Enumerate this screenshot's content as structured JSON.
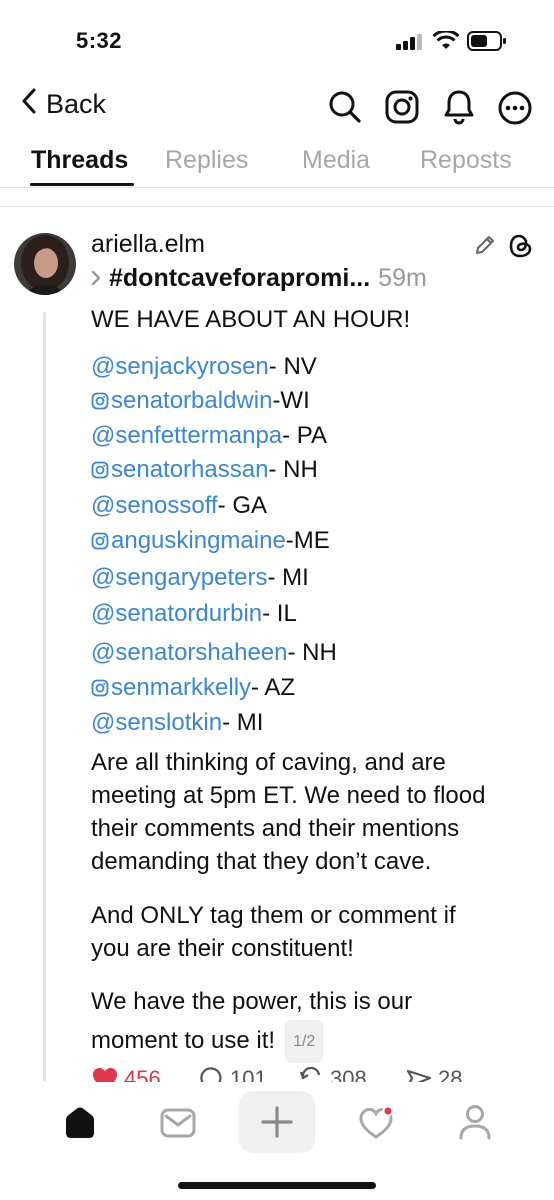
{
  "status": {
    "time": "5:32"
  },
  "nav": {
    "back_label": "Back"
  },
  "tabs": [
    "Threads",
    "Replies",
    "Media",
    "Reposts"
  ],
  "post": {
    "username": "ariella.elm",
    "tag": "#dontcaveforapromi...",
    "time": "59m",
    "headline": "WE HAVE ABOUT AN HOUR!",
    "mentions": [
      {
        "handle": "@senjackyrosen",
        "suffix": " - NV",
        "ig": false
      },
      {
        "handle": "senatorbaldwin",
        "suffix": " -WI",
        "ig": true
      },
      {
        "handle": "@senfettermanpa",
        "suffix": " - PA",
        "ig": false
      },
      {
        "handle": "senatorhassan",
        "suffix": " - NH",
        "ig": true
      },
      {
        "handle": "@senossoff",
        "suffix": " - GA",
        "ig": false
      },
      {
        "handle": "anguskingmaine",
        "suffix": " -ME",
        "ig": true
      },
      {
        "handle": "@sengarypeters",
        "suffix": " - MI",
        "ig": false
      },
      {
        "handle": "@senatordurbin",
        "suffix": " - IL",
        "ig": false
      },
      {
        "handle": "@senatorshaheen",
        "suffix": " - NH",
        "ig": false
      },
      {
        "handle": "senmarkkelly",
        "suffix": " - AZ",
        "ig": true
      },
      {
        "handle": "@senslotkin",
        "suffix": " - MI",
        "ig": false
      }
    ],
    "body1": [
      "Are all thinking of caving, and are",
      "meeting at 5pm ET. We need to flood",
      "their comments and their mentions",
      "demanding that they don’t cave."
    ],
    "body2": [
      "And ONLY tag them or comment if",
      "you are their constituent!"
    ],
    "body3": [
      "We have the power, this is our",
      "moment to use it!"
    ],
    "page_badge": "1/2",
    "stats": {
      "likes": "456",
      "comments": "101",
      "reposts": "308",
      "shares": "28"
    }
  },
  "colors": {
    "mention": "#3a86d8",
    "like": "#e0364a"
  }
}
